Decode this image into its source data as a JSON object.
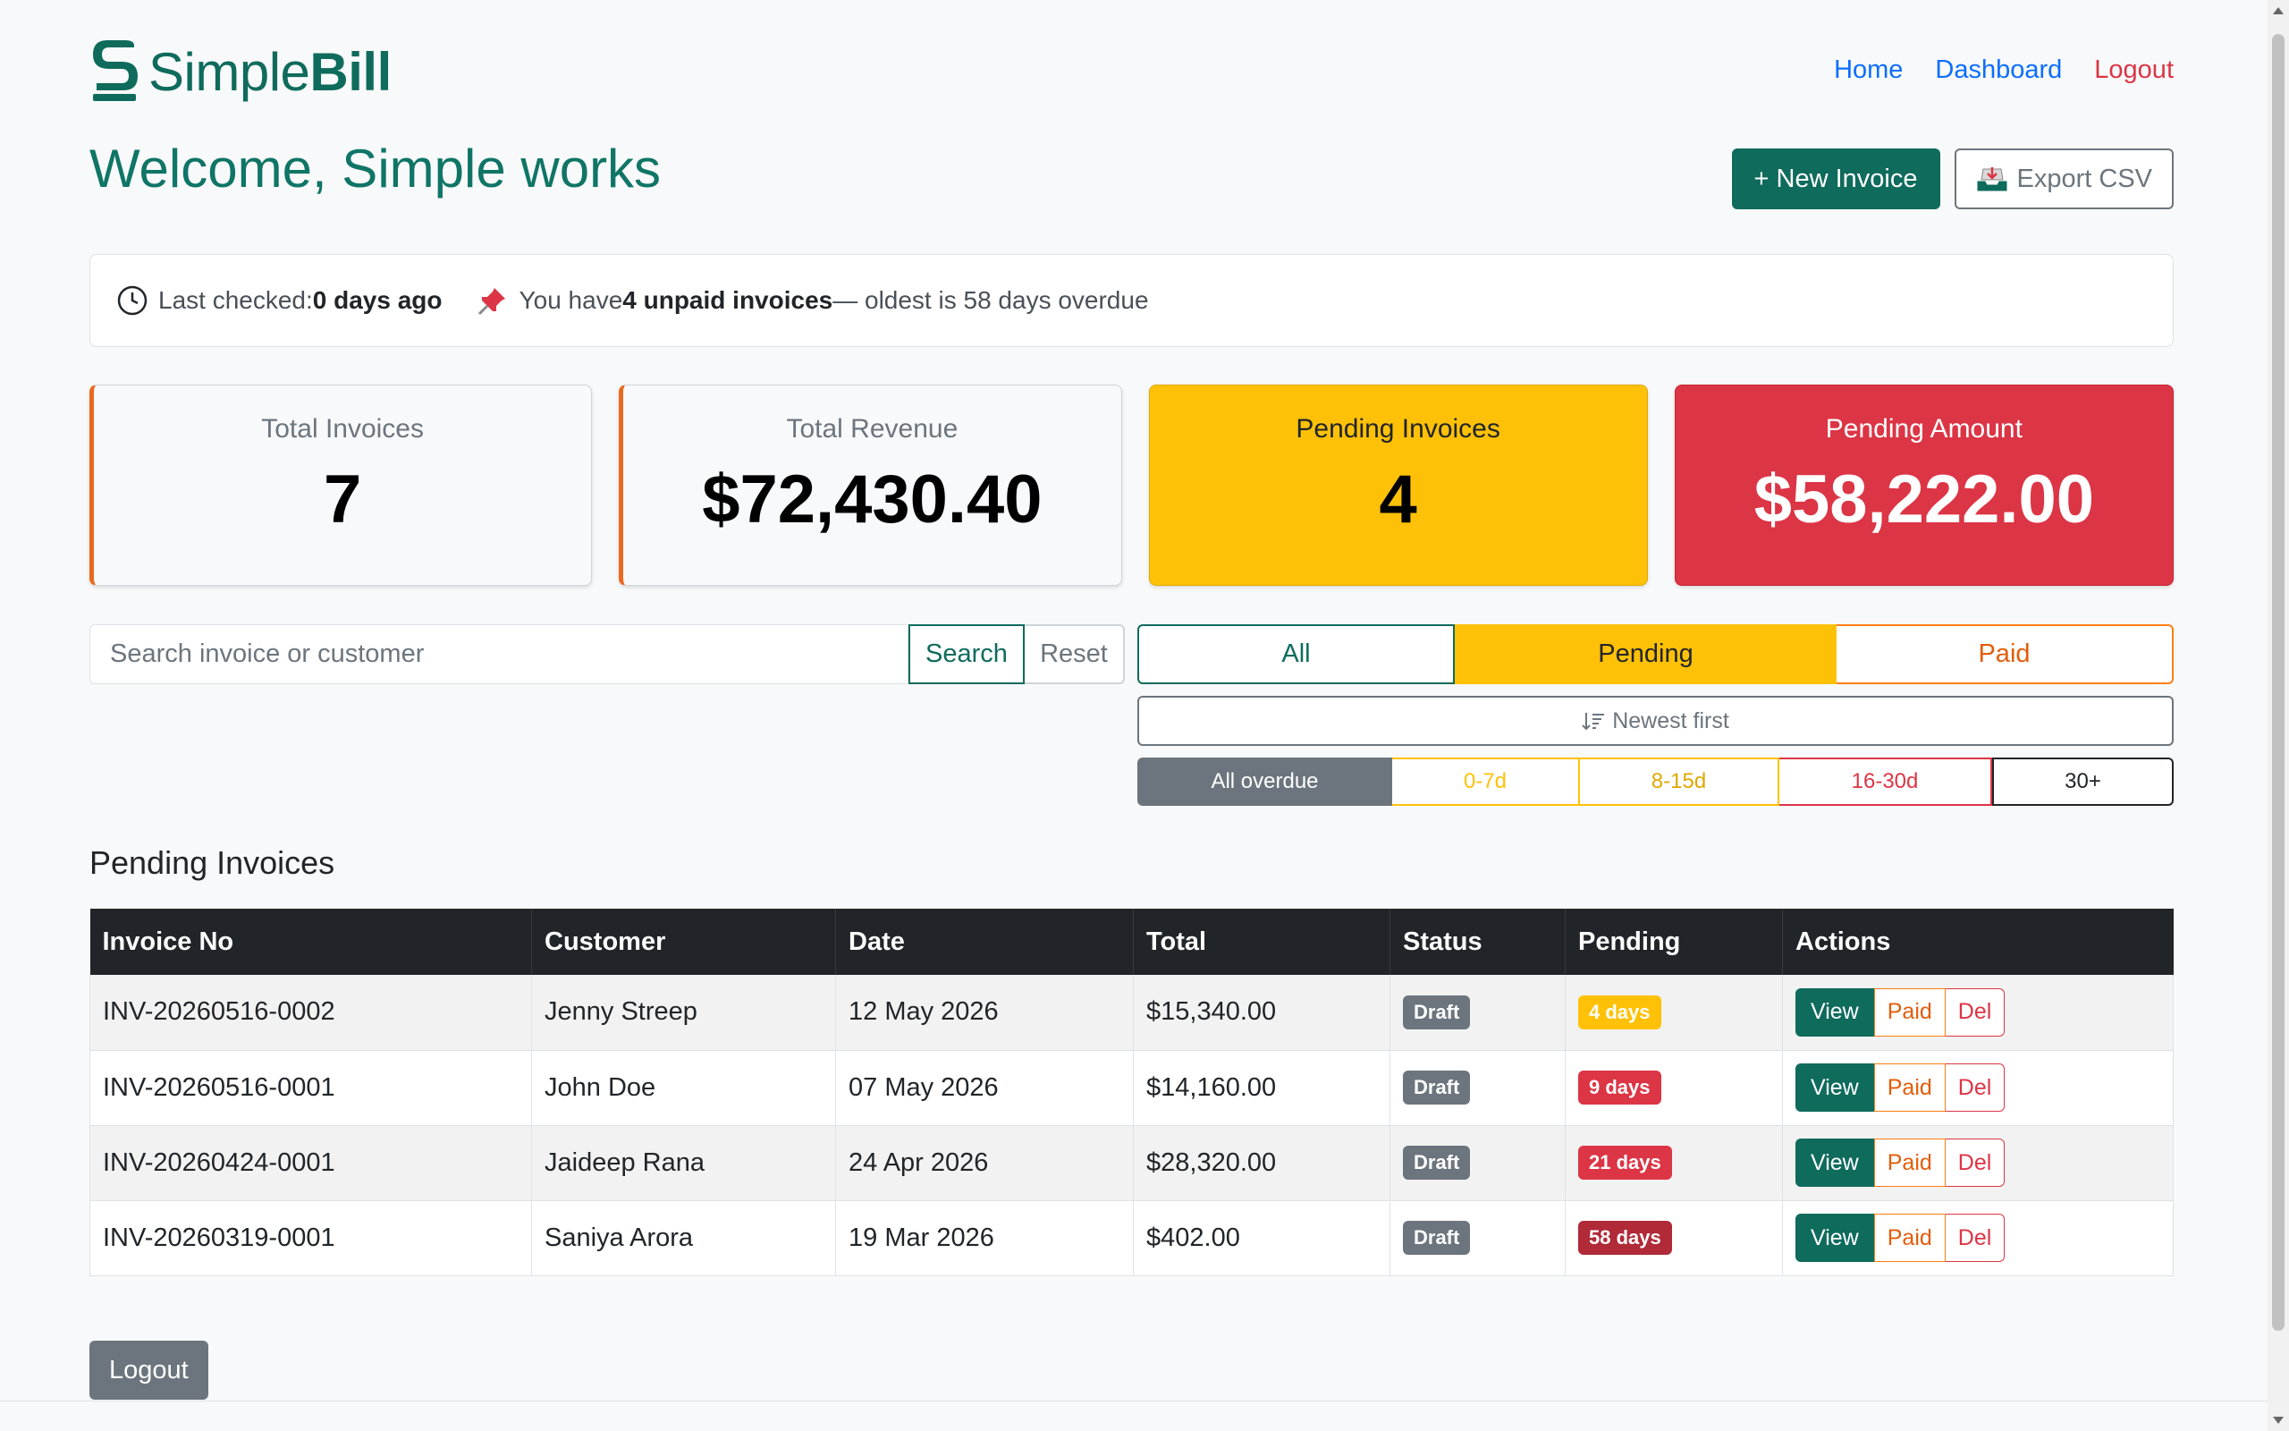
{
  "brand": {
    "logo_prefix": "Simple",
    "logo_suffix": "Bill",
    "color": "#0f6b5c"
  },
  "nav": {
    "home": "Home",
    "dashboard": "Dashboard",
    "logout": "Logout"
  },
  "header": {
    "welcome": "Welcome, Simple works",
    "new_invoice": "+ New Invoice",
    "export_csv": "Export CSV"
  },
  "infobar": {
    "last_checked_label": "Last checked: ",
    "last_checked_value": "0 days ago",
    "unpaid_prefix": "You have ",
    "unpaid_count": "4 unpaid invoices",
    "unpaid_suffix": " — oldest is 58 days overdue"
  },
  "cards": [
    {
      "label": "Total Invoices",
      "value": "7"
    },
    {
      "label": "Total Revenue",
      "value": "$72,430.40"
    },
    {
      "label": "Pending Invoices",
      "value": "4"
    },
    {
      "label": "Pending Amount",
      "value": "$58,222.00"
    }
  ],
  "search": {
    "placeholder": "Search invoice or customer",
    "value": "",
    "search_label": "Search",
    "reset_label": "Reset"
  },
  "status_filter": {
    "all": "All",
    "pending": "Pending",
    "paid": "Paid",
    "selected": "Pending"
  },
  "sort": {
    "label": "Newest first"
  },
  "age_filter": {
    "all": "All overdue",
    "d0_7": "0-7d",
    "d8_15": "8-15d",
    "d16_30": "16-30d",
    "d30": "30+",
    "selected": "All overdue"
  },
  "table": {
    "title": "Pending Invoices",
    "headers": [
      "Invoice No",
      "Customer",
      "Date",
      "Total",
      "Status",
      "Pending",
      "Actions"
    ],
    "rows": [
      {
        "invoice_no": "INV-20260516-0002",
        "customer": "Jenny Streep",
        "date": "12 May 2026",
        "total": "$15,340.00",
        "status": "Draft",
        "pending": "4 days",
        "pending_color": "#ffc107"
      },
      {
        "invoice_no": "INV-20260516-0001",
        "customer": "John Doe",
        "date": "07 May 2026",
        "total": "$14,160.00",
        "status": "Draft",
        "pending": "9 days",
        "pending_color": "#dc3545"
      },
      {
        "invoice_no": "INV-20260424-0001",
        "customer": "Jaideep Rana",
        "date": "24 Apr 2026",
        "total": "$28,320.00",
        "status": "Draft",
        "pending": "21 days",
        "pending_color": "#dc3545"
      },
      {
        "invoice_no": "INV-20260319-0001",
        "customer": "Saniya Arora",
        "date": "19 Mar 2026",
        "total": "$402.00",
        "status": "Draft",
        "pending": "58 days",
        "pending_color": "#b02a37"
      }
    ],
    "actions": {
      "view": "View",
      "paid": "Paid",
      "del": "Del"
    }
  },
  "footer": {
    "logout": "Logout"
  }
}
